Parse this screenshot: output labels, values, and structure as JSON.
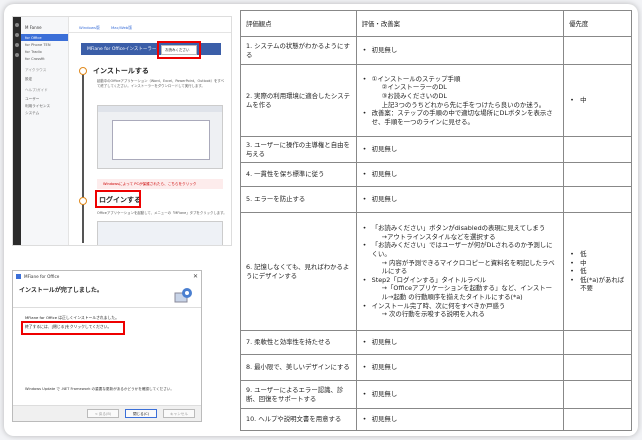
{
  "web": {
    "sidebar_title": "M Fanne",
    "sidebar_items": [
      "for Office",
      "for Phone TEN",
      "for Tradix",
      "for Crossfit"
    ],
    "sidebar_section": "アイクラウス",
    "sidebar_section2": "設定",
    "sidebar_section3": "ヘルプ/ガイド",
    "sidebar_items2": [
      "ユーザー",
      "利用ライセンス",
      "システム"
    ],
    "tabs": [
      "Windows版",
      "Mac/Web版"
    ],
    "header": "MFiane for Officeインストーラー",
    "download_button": "お読みください",
    "step1": "インストールする",
    "step1_text": "起動中のOfficeアプリケーション（Word、Excel、PowerPoint、Outlook）をすべて終了してください。インストーラーをダウンロードして実行します。",
    "warning": "Windowsによって PCが保護されたら、こちらをクリック",
    "step2": "ログインする",
    "step2_text": "Officeアプリケーションを起動して、メニューの「MFiane」タブをクリックします。"
  },
  "dialog": {
    "title": "MFiane for Office",
    "close": "✕",
    "heading": "インストールが完了しました。",
    "line1": "MFiane for Office は正しくインストールされました。",
    "line2": "終了するには、[閉じる]をクリックしてください。",
    "line3": "Windows Update で .NET Framework の重要な更新があるかどうかを確認してください。",
    "back": "< 戻る(B)",
    "close_btn": "閉じる(C)",
    "cancel": "キャンセル"
  },
  "table": {
    "headers": [
      "評価観点",
      "評価・改善案",
      "優先度"
    ],
    "rows": [
      {
        "title": "1. システムの状態がわかるようにする",
        "items": [
          "初見無し"
        ],
        "priority": []
      },
      {
        "title": "2. 実際の利用環境に適合したシステムを作る",
        "items": [
          "①インストールのステップ手順",
          "②インストーラーのDL",
          "③お読みくださいのDL",
          "上記3つのうちどれから先に手をつけたら良いのか迷う。",
          "改善案：ステップの手順の中で適切な場所にDLボタンを表示させ、手順を一つのラインに見せる。"
        ],
        "priority": [
          "中"
        ]
      },
      {
        "title": "3. ユーザーに操作の主導権と自由を与える",
        "items": [
          "初見無し"
        ],
        "priority": []
      },
      {
        "title": "4. 一貫性を保ち標準に従う",
        "items": [
          "初見無し"
        ],
        "priority": []
      },
      {
        "title": "5. エラーを防止する",
        "items": [
          "初見無し"
        ],
        "priority": []
      },
      {
        "title": "6. 記憶しなくても、見ればわかるようにデザインする",
        "items": [
          "「お読みください」ボタンがdisabledの表現に見えてしまう",
          "→アウトラインスタイルなどを選択する",
          "「お読みください」ではユーザーが何がDLされるのか予測しにくい。",
          "→ 内容が予測できるマイクロコピーと資料名を明記したラベルにする",
          "Step2「ログインする」タイトルラベル",
          "→「Officeアプリケーションを起動する」など、インストール→起動 の行動順序を揃えたタイトルにする(*a)",
          "インストール完了時、次に何をすべきか戸惑う",
          "→ 次の行動を示唆する説明を入れる"
        ],
        "priority": [
          "低",
          "中",
          "低",
          "低(*a)があれば不要"
        ]
      },
      {
        "title": "7. 柔軟性と効率性を持たせる",
        "items": [
          "初見無し"
        ],
        "priority": []
      },
      {
        "title": "8. 最小限で、美しいデザインにする",
        "items": [
          "初見無し"
        ],
        "priority": []
      },
      {
        "title": "9. ユーザーによるエラー認識、診断、回復をサポートする",
        "items": [
          "初見無し"
        ],
        "priority": []
      },
      {
        "title": "10. ヘルプや説明文書を用意する",
        "items": [
          "初見無し"
        ],
        "priority": []
      }
    ]
  }
}
